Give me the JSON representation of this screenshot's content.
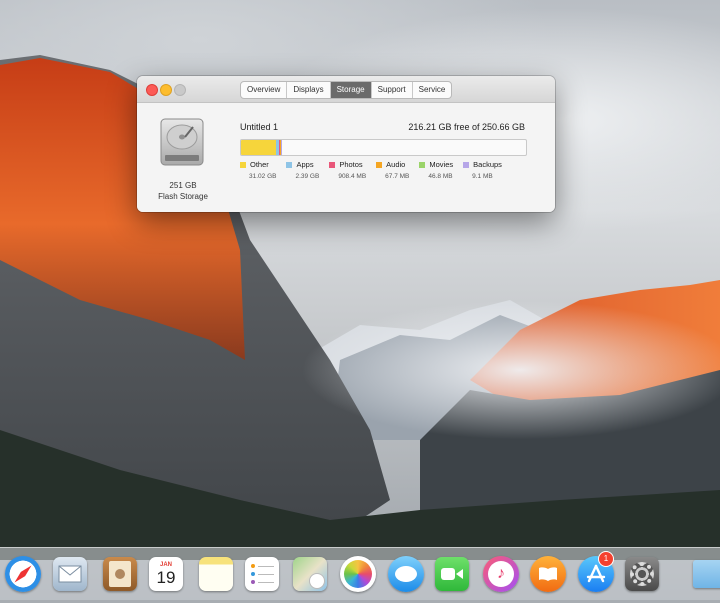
{
  "window": {
    "tabs": [
      {
        "label": "Overview",
        "active": false
      },
      {
        "label": "Displays",
        "active": false
      },
      {
        "label": "Storage",
        "active": true
      },
      {
        "label": "Support",
        "active": false
      },
      {
        "label": "Service",
        "active": false
      }
    ]
  },
  "storage": {
    "disk_size": "251 GB",
    "disk_type": "Flash Storage",
    "volume_name": "Untitled 1",
    "free_text": "216.21 GB free of 250.66 GB",
    "categories": [
      {
        "label": "Other",
        "size": "31.02 GB",
        "color": "#f6d53b",
        "fraction": 0.124
      },
      {
        "label": "Apps",
        "size": "2.39 GB",
        "color": "#8ec4e6",
        "fraction": 0.01
      },
      {
        "label": "Photos",
        "size": "908.4 MB",
        "color": "#e9577a",
        "fraction": 0.004
      },
      {
        "label": "Audio",
        "size": "67.7 MB",
        "color": "#f5a623",
        "fraction": 0.002
      },
      {
        "label": "Movies",
        "size": "46.8 MB",
        "color": "#9bd46a",
        "fraction": 0.002
      },
      {
        "label": "Backups",
        "size": "9.1 MB",
        "color": "#b6a6e8",
        "fraction": 0.001
      }
    ]
  },
  "dock": {
    "items": [
      {
        "name": "safari-icon"
      },
      {
        "name": "mail-icon"
      },
      {
        "name": "contacts-icon"
      },
      {
        "name": "calendar-icon",
        "month": "JAN",
        "day": "19"
      },
      {
        "name": "notes-icon"
      },
      {
        "name": "reminders-icon"
      },
      {
        "name": "maps-icon"
      },
      {
        "name": "photos-icon"
      },
      {
        "name": "messages-icon"
      },
      {
        "name": "facetime-icon"
      },
      {
        "name": "itunes-icon"
      },
      {
        "name": "ibooks-icon"
      },
      {
        "name": "app-store-icon",
        "badge": "1"
      },
      {
        "name": "system-preferences-icon"
      },
      {
        "name": "folder-icon"
      }
    ]
  }
}
